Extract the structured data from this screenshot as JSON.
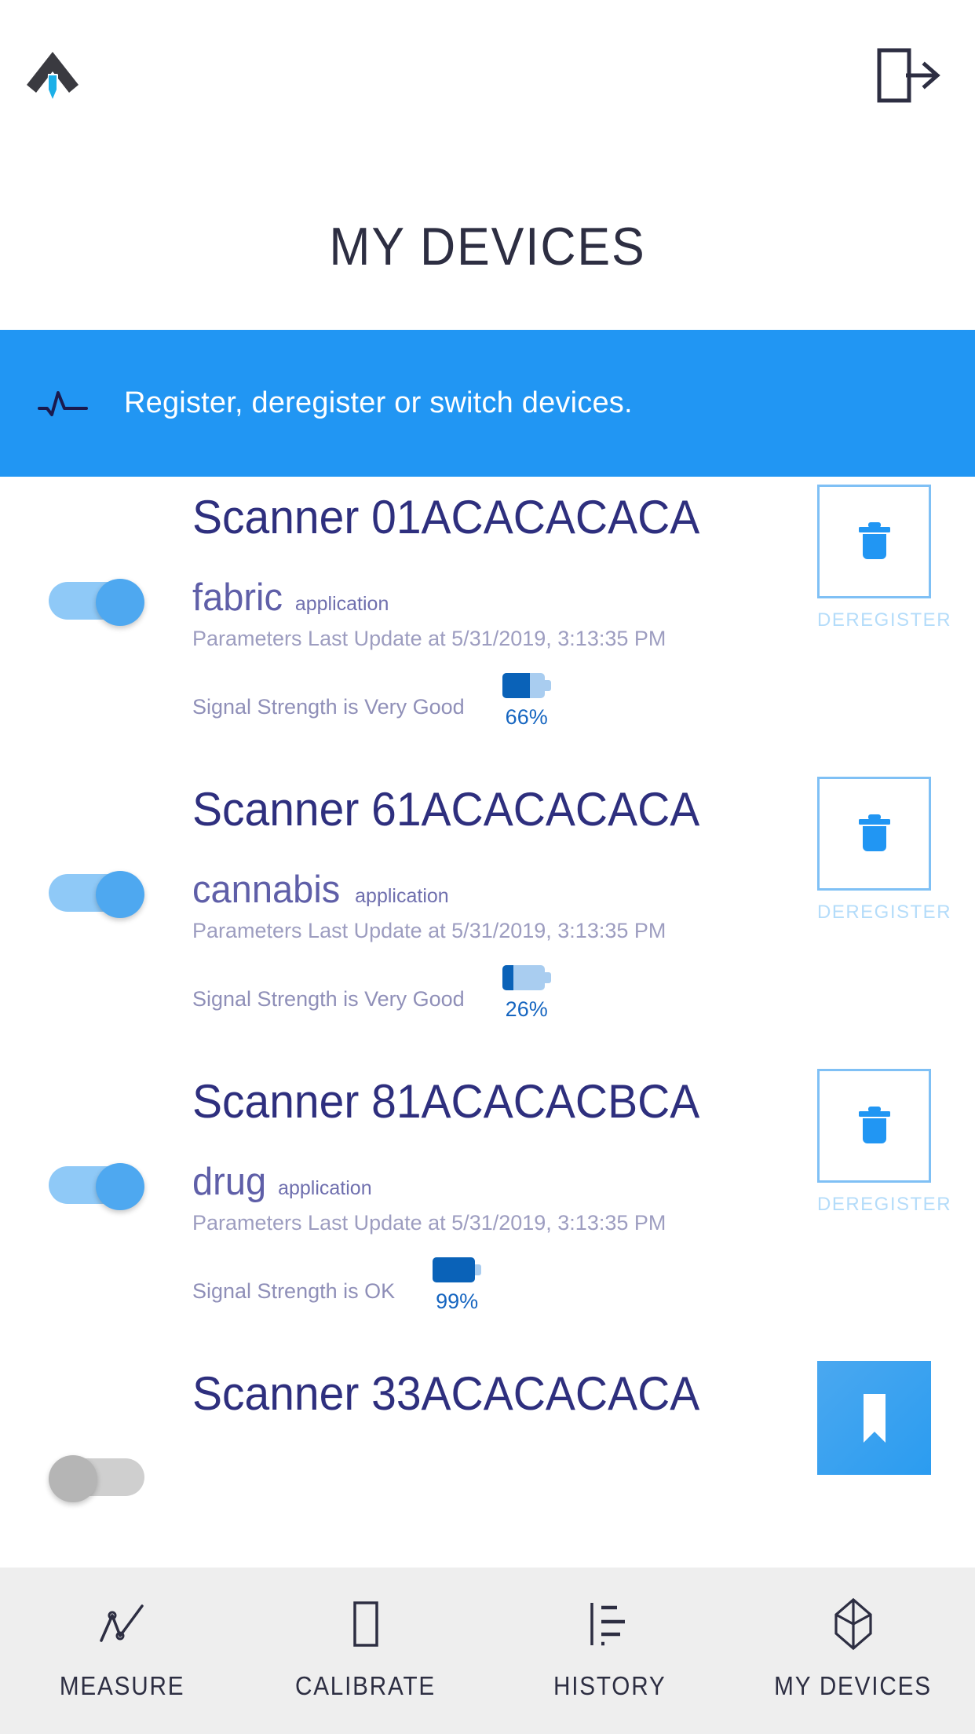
{
  "header": {
    "logo_icon": "app-logo-icon",
    "logout_icon": "logout-icon",
    "title": "MY DEVICES"
  },
  "banner": {
    "icon": "waveform-icon",
    "text": "Register, deregister or switch devices.",
    "background": "#2196f3",
    "text_color": "#ffffff"
  },
  "devices": [
    {
      "name": "Scanner 01ACACACACA",
      "application": "fabric",
      "application_label": "application",
      "parameters": "Parameters Last Update at 5/31/2019, 3:13:35 PM",
      "signal": "Signal Strength is Very Good",
      "battery_pct": "66%",
      "battery_value": 66,
      "toggle_on": true,
      "action_label": "DEREGISTER",
      "action_icon": "trash-icon",
      "action_state": "outline"
    },
    {
      "name": "Scanner 61ACACACACA",
      "application": "cannabis",
      "application_label": "application",
      "parameters": "Parameters Last Update at 5/31/2019, 3:13:35 PM",
      "signal": "Signal Strength is Very Good",
      "battery_pct": "26%",
      "battery_value": 26,
      "toggle_on": true,
      "action_label": "DEREGISTER",
      "action_icon": "trash-icon",
      "action_state": "outline"
    },
    {
      "name": "Scanner 81ACACACBCA",
      "application": "drug",
      "application_label": "application",
      "parameters": "Parameters Last Update at 5/31/2019, 3:13:35 PM",
      "signal": "Signal Strength is OK",
      "battery_pct": "99%",
      "battery_value": 99,
      "toggle_on": true,
      "action_label": "DEREGISTER",
      "action_icon": "trash-icon",
      "action_state": "outline"
    },
    {
      "name": "Scanner 33ACACACACA",
      "application": "",
      "application_label": "",
      "parameters": "",
      "signal": "",
      "battery_pct": "",
      "battery_value": 0,
      "toggle_on": false,
      "action_label": "",
      "action_icon": "bookmark-icon",
      "action_state": "filled"
    }
  ],
  "bottom_nav": {
    "items": [
      {
        "label": "MEASURE",
        "icon": "measure-line-icon",
        "active": false
      },
      {
        "label": "CALIBRATE",
        "icon": "rectangle-icon",
        "active": false
      },
      {
        "label": "HISTORY",
        "icon": "history-list-icon",
        "active": false
      },
      {
        "label": "MY DEVICES",
        "icon": "cube-icon",
        "active": true
      }
    ]
  },
  "colors": {
    "accent_blue": "#2196f3",
    "deep_navy": "#2e2f7e",
    "battery_fill": "#0a62b8",
    "toggle_on": "#4ea8f0",
    "toggle_off": "#b5b5b5"
  }
}
